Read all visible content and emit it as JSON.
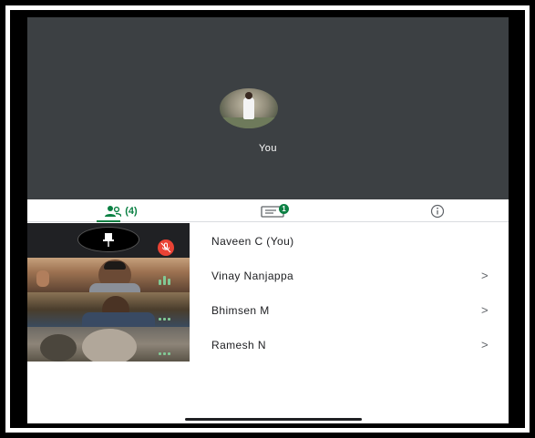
{
  "stage": {
    "self_label": "You"
  },
  "tabs": {
    "people_count": "(4)",
    "chat_badge": "1"
  },
  "participants": [
    {
      "name": "Naveen C (You)",
      "has_chevron": false
    },
    {
      "name": "Vinay Nanjappa",
      "chevron": ">"
    },
    {
      "name": "Bhimsen M",
      "chevron": ">"
    },
    {
      "name": "Ramesh N",
      "chevron": ">"
    }
  ],
  "colors": {
    "stage_bg": "#3c4043",
    "accent_green": "#0b8043",
    "muted_red": "#ea4335",
    "speaking_green": "#81c995"
  },
  "icons": [
    "people-icon",
    "chat-icon",
    "info-icon",
    "pin-icon",
    "mic-off-icon",
    "speaking-indicator-icon"
  ]
}
